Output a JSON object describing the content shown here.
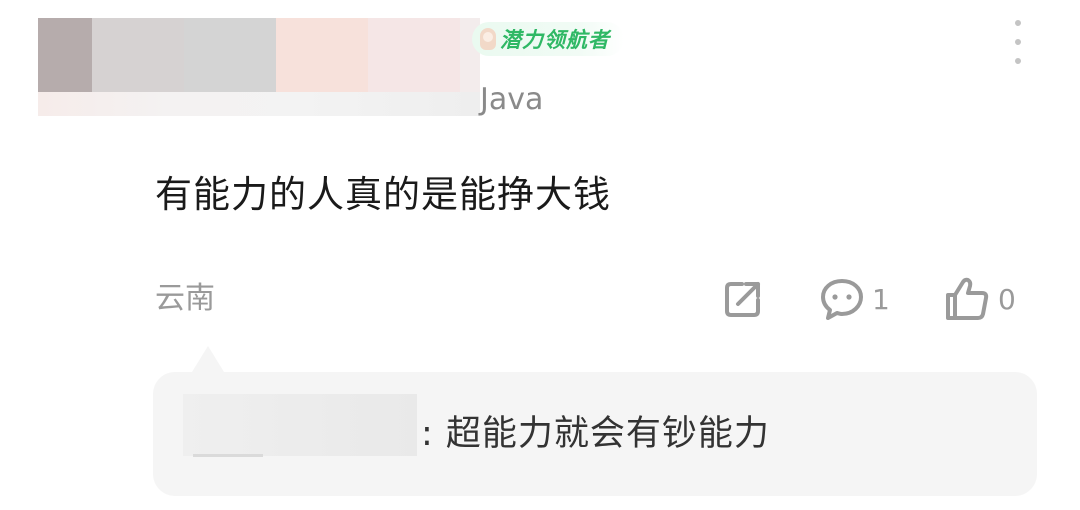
{
  "post": {
    "badge_label": "潜力领航者",
    "subtitle": "Java",
    "content": "有能力的人真的是能挣大钱",
    "location": "云南",
    "comment_count": "1",
    "like_count": "0"
  },
  "reply": {
    "text": ": 超能力就会有钞能力"
  },
  "colors": {
    "badge_green": "#2fb865",
    "icon_gray": "#9a9a9a",
    "reply_bg": "#f5f5f5"
  }
}
